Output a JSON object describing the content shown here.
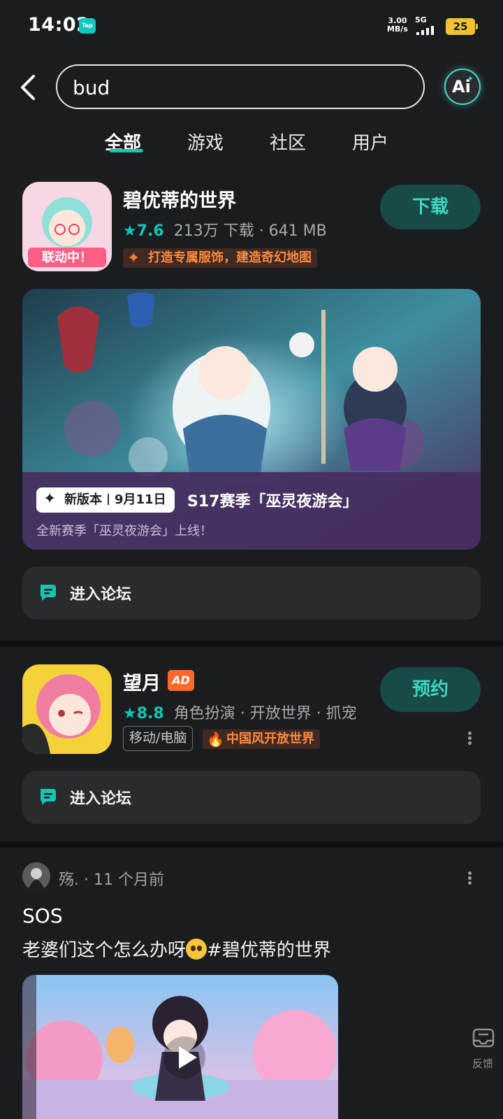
{
  "status_bar": {
    "time": "14:02",
    "app_badge": "Tap",
    "speed_value": "3.00",
    "speed_unit": "MB/s",
    "network": "5G",
    "battery": "25"
  },
  "search": {
    "query": "bud",
    "ai_label": "Ai"
  },
  "tabs": [
    {
      "label": "全部",
      "active": true
    },
    {
      "label": "游戏",
      "active": false
    },
    {
      "label": "社区",
      "active": false
    },
    {
      "label": "用户",
      "active": false
    }
  ],
  "results": {
    "app1": {
      "icon_badge": "联动中！",
      "name": "碧优蒂的世界",
      "rating": "7.6",
      "meta": "213万 下载 · 641 MB",
      "tagline": "打造专属服饰，建造奇幻地图",
      "button": "下载",
      "banner": {
        "chip_label": "新版本",
        "chip_date": "9月11日",
        "headline": "S17赛季「巫灵夜游会」",
        "sub": "全新赛季「巫灵夜游会」上线！"
      },
      "forum": "进入论坛"
    },
    "app2": {
      "name": "望月",
      "ad": "AD",
      "rating": "8.8",
      "meta": "角色扮演 · 开放世界 · 抓宠",
      "platform_tag": "移动/电脑",
      "tagline": "中国风开放世界",
      "button": "预约",
      "forum": "进入论坛"
    }
  },
  "post": {
    "meta": "殇. · 11 个月前",
    "title": "SOS",
    "body_before": "老婆们这个怎么办呀",
    "body_after": "#碧优蒂的世界"
  },
  "feedback": "反馈",
  "colors": {
    "background": "#1b1c1f",
    "accent": "#15c5b4",
    "button_bg": "#184b47",
    "orange": "#ff7a33"
  }
}
